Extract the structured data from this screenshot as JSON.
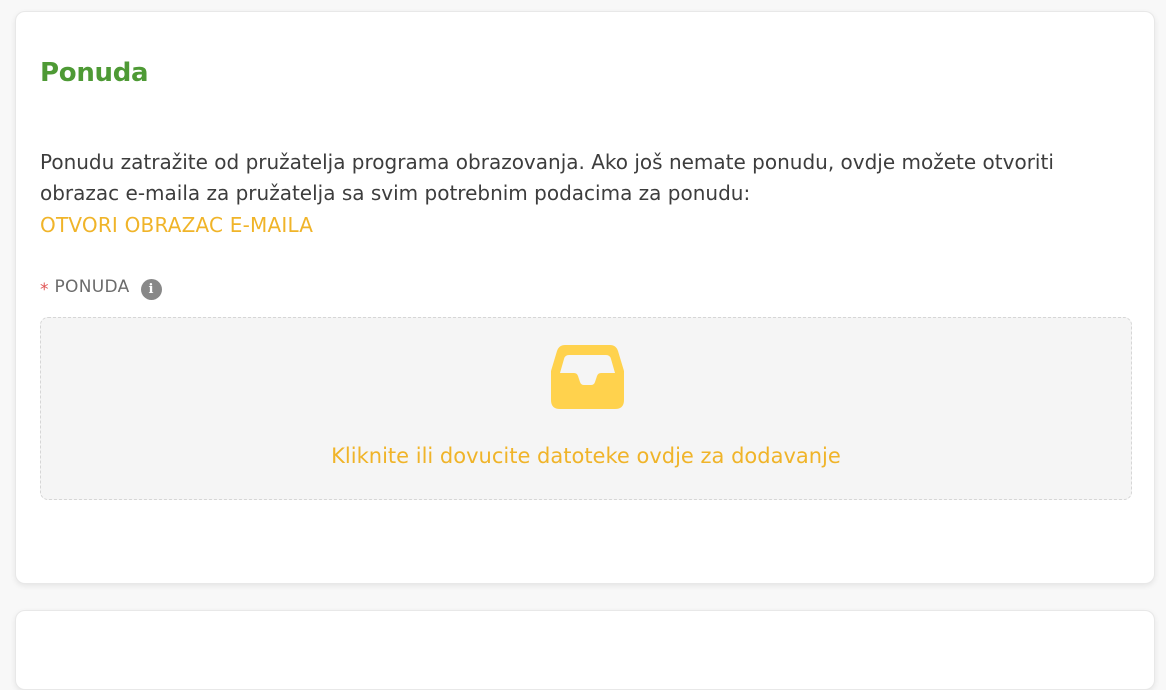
{
  "offer_section": {
    "title": "Ponuda",
    "description": "Ponudu zatražite od pružatelja programa obrazovanja. Ako još nemate ponudu, ovdje možete otvoriti obrazac e-maila za pružatelja sa svim potrebnim podacima za ponudu:",
    "email_link": "OTVORI OBRAZAC E-MAILA",
    "field": {
      "required_mark": "*",
      "label": "PONUDA",
      "info_glyph": "i"
    },
    "dropzone": {
      "icon": "inbox-icon",
      "hint": "Kliknite ili dovucite datoteke ovdje za dodavanje"
    }
  },
  "colors": {
    "title_green": "#4e9a35",
    "accent_yellow": "#f0b429",
    "icon_yellow": "#ffd24d",
    "required_red": "#e05555"
  }
}
